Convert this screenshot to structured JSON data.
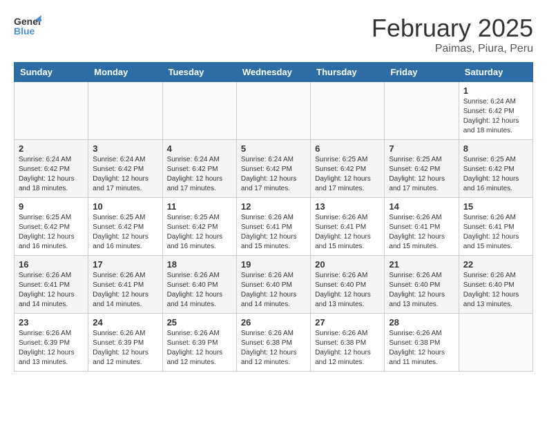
{
  "logo": {
    "line1": "General",
    "line2": "Blue"
  },
  "title": "February 2025",
  "location": "Paimas, Piura, Peru",
  "weekdays": [
    "Sunday",
    "Monday",
    "Tuesday",
    "Wednesday",
    "Thursday",
    "Friday",
    "Saturday"
  ],
  "weeks": [
    [
      {
        "day": "",
        "info": ""
      },
      {
        "day": "",
        "info": ""
      },
      {
        "day": "",
        "info": ""
      },
      {
        "day": "",
        "info": ""
      },
      {
        "day": "",
        "info": ""
      },
      {
        "day": "",
        "info": ""
      },
      {
        "day": "1",
        "info": "Sunrise: 6:24 AM\nSunset: 6:42 PM\nDaylight: 12 hours\nand 18 minutes."
      }
    ],
    [
      {
        "day": "2",
        "info": "Sunrise: 6:24 AM\nSunset: 6:42 PM\nDaylight: 12 hours\nand 18 minutes."
      },
      {
        "day": "3",
        "info": "Sunrise: 6:24 AM\nSunset: 6:42 PM\nDaylight: 12 hours\nand 17 minutes."
      },
      {
        "day": "4",
        "info": "Sunrise: 6:24 AM\nSunset: 6:42 PM\nDaylight: 12 hours\nand 17 minutes."
      },
      {
        "day": "5",
        "info": "Sunrise: 6:24 AM\nSunset: 6:42 PM\nDaylight: 12 hours\nand 17 minutes."
      },
      {
        "day": "6",
        "info": "Sunrise: 6:25 AM\nSunset: 6:42 PM\nDaylight: 12 hours\nand 17 minutes."
      },
      {
        "day": "7",
        "info": "Sunrise: 6:25 AM\nSunset: 6:42 PM\nDaylight: 12 hours\nand 17 minutes."
      },
      {
        "day": "8",
        "info": "Sunrise: 6:25 AM\nSunset: 6:42 PM\nDaylight: 12 hours\nand 16 minutes."
      }
    ],
    [
      {
        "day": "9",
        "info": "Sunrise: 6:25 AM\nSunset: 6:42 PM\nDaylight: 12 hours\nand 16 minutes."
      },
      {
        "day": "10",
        "info": "Sunrise: 6:25 AM\nSunset: 6:42 PM\nDaylight: 12 hours\nand 16 minutes."
      },
      {
        "day": "11",
        "info": "Sunrise: 6:25 AM\nSunset: 6:42 PM\nDaylight: 12 hours\nand 16 minutes."
      },
      {
        "day": "12",
        "info": "Sunrise: 6:26 AM\nSunset: 6:41 PM\nDaylight: 12 hours\nand 15 minutes."
      },
      {
        "day": "13",
        "info": "Sunrise: 6:26 AM\nSunset: 6:41 PM\nDaylight: 12 hours\nand 15 minutes."
      },
      {
        "day": "14",
        "info": "Sunrise: 6:26 AM\nSunset: 6:41 PM\nDaylight: 12 hours\nand 15 minutes."
      },
      {
        "day": "15",
        "info": "Sunrise: 6:26 AM\nSunset: 6:41 PM\nDaylight: 12 hours\nand 15 minutes."
      }
    ],
    [
      {
        "day": "16",
        "info": "Sunrise: 6:26 AM\nSunset: 6:41 PM\nDaylight: 12 hours\nand 14 minutes."
      },
      {
        "day": "17",
        "info": "Sunrise: 6:26 AM\nSunset: 6:41 PM\nDaylight: 12 hours\nand 14 minutes."
      },
      {
        "day": "18",
        "info": "Sunrise: 6:26 AM\nSunset: 6:40 PM\nDaylight: 12 hours\nand 14 minutes."
      },
      {
        "day": "19",
        "info": "Sunrise: 6:26 AM\nSunset: 6:40 PM\nDaylight: 12 hours\nand 14 minutes."
      },
      {
        "day": "20",
        "info": "Sunrise: 6:26 AM\nSunset: 6:40 PM\nDaylight: 12 hours\nand 13 minutes."
      },
      {
        "day": "21",
        "info": "Sunrise: 6:26 AM\nSunset: 6:40 PM\nDaylight: 12 hours\nand 13 minutes."
      },
      {
        "day": "22",
        "info": "Sunrise: 6:26 AM\nSunset: 6:40 PM\nDaylight: 12 hours\nand 13 minutes."
      }
    ],
    [
      {
        "day": "23",
        "info": "Sunrise: 6:26 AM\nSunset: 6:39 PM\nDaylight: 12 hours\nand 13 minutes."
      },
      {
        "day": "24",
        "info": "Sunrise: 6:26 AM\nSunset: 6:39 PM\nDaylight: 12 hours\nand 12 minutes."
      },
      {
        "day": "25",
        "info": "Sunrise: 6:26 AM\nSunset: 6:39 PM\nDaylight: 12 hours\nand 12 minutes."
      },
      {
        "day": "26",
        "info": "Sunrise: 6:26 AM\nSunset: 6:38 PM\nDaylight: 12 hours\nand 12 minutes."
      },
      {
        "day": "27",
        "info": "Sunrise: 6:26 AM\nSunset: 6:38 PM\nDaylight: 12 hours\nand 12 minutes."
      },
      {
        "day": "28",
        "info": "Sunrise: 6:26 AM\nSunset: 6:38 PM\nDaylight: 12 hours\nand 11 minutes."
      },
      {
        "day": "",
        "info": ""
      }
    ]
  ]
}
